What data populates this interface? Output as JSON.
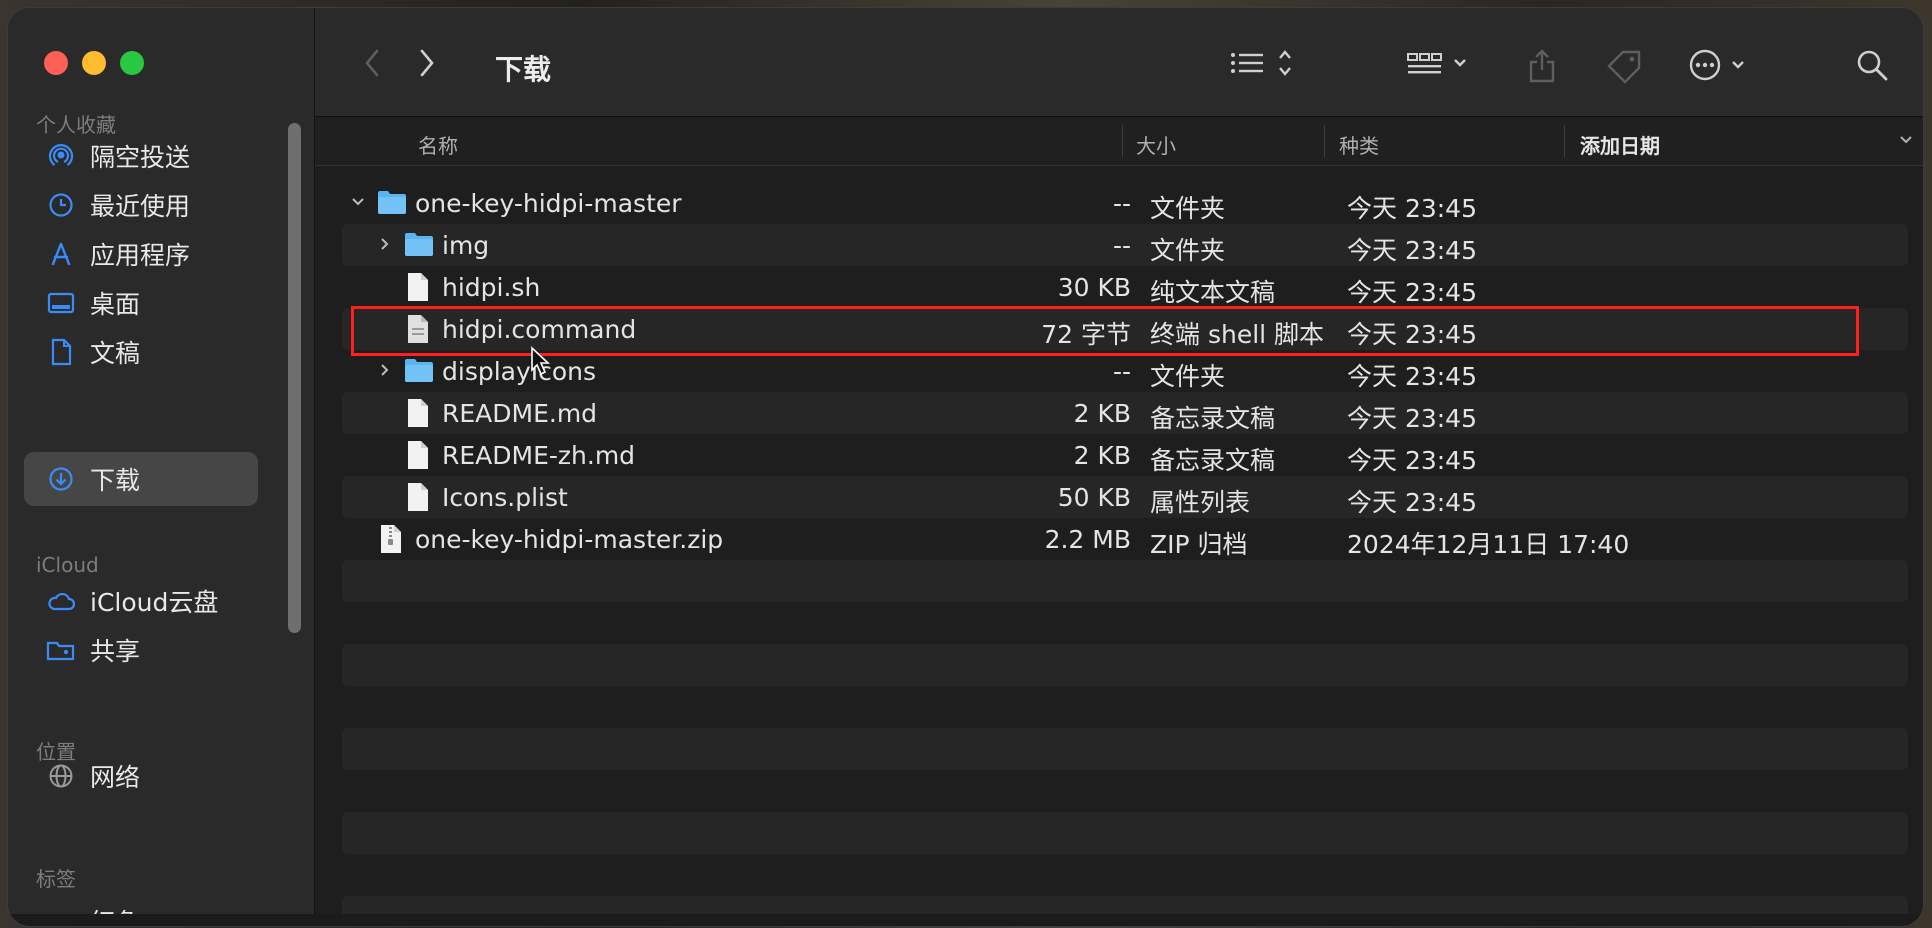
{
  "window": {
    "title": "下载"
  },
  "colors": {
    "folder_blue": "#5ab4f0",
    "highlight_red": "#ff1f1f",
    "accent": "#3a8cf5"
  },
  "sidebar": {
    "sections": [
      {
        "title": "个人收藏"
      },
      {
        "title": "iCloud"
      },
      {
        "title": "位置"
      },
      {
        "title": "标签"
      }
    ],
    "items": [
      {
        "label": "隔空投送",
        "icon": "airdrop-icon"
      },
      {
        "label": "最近使用",
        "icon": "clock-icon"
      },
      {
        "label": "应用程序",
        "icon": "applications-icon"
      },
      {
        "label": "桌面",
        "icon": "desktop-icon"
      },
      {
        "label": "文稿",
        "icon": "document-icon"
      },
      {
        "label": "下载",
        "icon": "download-icon",
        "selected": true
      },
      {
        "label": "iCloud云盘",
        "icon": "cloud-icon"
      },
      {
        "label": "共享",
        "icon": "shared-folder-icon"
      },
      {
        "label": "网络",
        "icon": "globe-icon"
      },
      {
        "label": "红色",
        "icon": "red-tag-icon"
      }
    ]
  },
  "columns": {
    "name": "名称",
    "size": "大小",
    "kind": "种类",
    "date": "添加日期"
  },
  "files": [
    {
      "name": "one-key-hidpi-master",
      "size": "--",
      "kind": "文件夹",
      "date": "今天 23:45",
      "type": "folder",
      "expanded": true,
      "depth": 0
    },
    {
      "name": "img",
      "size": "--",
      "kind": "文件夹",
      "date": "今天 23:45",
      "type": "folder",
      "expanded": false,
      "depth": 1
    },
    {
      "name": "hidpi.sh",
      "size": "30 KB",
      "kind": "纯文本文稿",
      "date": "今天 23:45",
      "type": "doc",
      "depth": 1
    },
    {
      "name": "hidpi.command",
      "size": "72 字节",
      "kind": "终端 shell 脚本",
      "date": "今天 23:45",
      "type": "doc",
      "depth": 1
    },
    {
      "name": "displayIcons",
      "size": "--",
      "kind": "文件夹",
      "date": "今天 23:45",
      "type": "folder",
      "expanded": false,
      "depth": 1
    },
    {
      "name": "README.md",
      "size": "2 KB",
      "kind": "备忘录文稿",
      "date": "今天 23:45",
      "type": "doc",
      "depth": 1
    },
    {
      "name": "README-zh.md",
      "size": "2 KB",
      "kind": "备忘录文稿",
      "date": "今天 23:45",
      "type": "doc",
      "depth": 1
    },
    {
      "name": "Icons.plist",
      "size": "50 KB",
      "kind": "属性列表",
      "date": "今天 23:45",
      "type": "doc",
      "depth": 1
    },
    {
      "name": "one-key-hidpi-master.zip",
      "size": "2.2 MB",
      "kind": "ZIP 归档",
      "date": "2024年12月11日 17:40",
      "type": "zip",
      "depth": 0
    }
  ]
}
